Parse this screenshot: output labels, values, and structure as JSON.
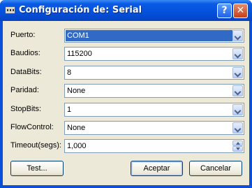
{
  "window": {
    "title": "Configuración de: Serial"
  },
  "titlebar_buttons": {
    "help": "?",
    "close": "✕"
  },
  "fields": [
    {
      "label": "Puerto:",
      "value": "COM1",
      "control": "combo",
      "selected": true
    },
    {
      "label": "Baudios:",
      "value": "115200",
      "control": "combo"
    },
    {
      "label": "DataBits:",
      "value": "8",
      "control": "combo"
    },
    {
      "label": "Paridad:",
      "value": "None",
      "control": "combo"
    },
    {
      "label": "StopBits:",
      "value": "1",
      "control": "combo"
    },
    {
      "label": "FlowControl:",
      "value": "None",
      "control": "combo"
    },
    {
      "label": "Timeout(segs):",
      "value": "1,000",
      "control": "spinner"
    }
  ],
  "buttons": {
    "test": "Test...",
    "accept": "Aceptar",
    "cancel": "Cancelar"
  },
  "colors": {
    "titlebar": "#0450db",
    "client_bg": "#ece9d8",
    "selection": "#316ac5",
    "field_border": "#7f9db9"
  }
}
